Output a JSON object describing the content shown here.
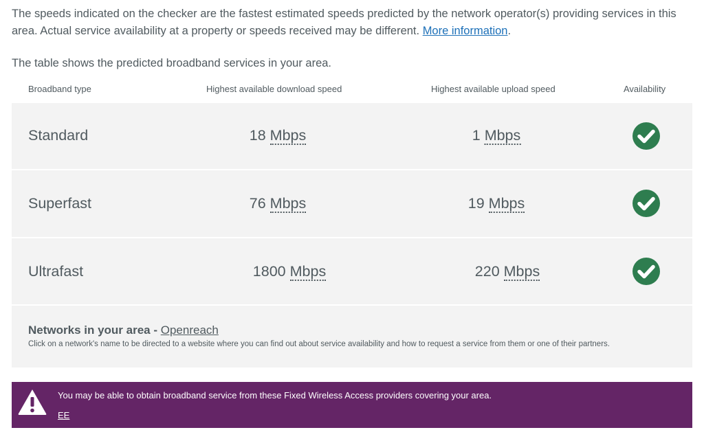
{
  "intro": {
    "text": "The speeds indicated on the checker are the fastest estimated speeds predicted by the network operator(s) providing services in this area. Actual service availability at a property or speeds received may be different.",
    "link_text": "More information",
    "after_link": "."
  },
  "table": {
    "caption": "The table shows the predicted broadband services in your area.",
    "headers": {
      "type": "Broadband type",
      "download": "Highest available download speed",
      "upload": "Highest available upload speed",
      "availability": "Availability"
    },
    "unit": "Mbps",
    "rows": [
      {
        "type": "Standard",
        "download": "18",
        "upload": "1",
        "available": true
      },
      {
        "type": "Superfast",
        "download": "76",
        "upload": "19",
        "available": true
      },
      {
        "type": "Ultrafast",
        "download": "1800",
        "upload": "220",
        "available": true
      }
    ]
  },
  "networks": {
    "title": "Networks in your area -",
    "provider": "Openreach",
    "help": "Click on a network's name to be directed to a website where you can find out about service availability and how to request a service from them or one of their partners."
  },
  "notice": {
    "text": "You may be able to obtain broadband service from these Fixed Wireless Access providers covering your area.",
    "provider": "EE",
    "icon": "warning-icon"
  },
  "colors": {
    "text": "#505a5f",
    "link": "#1d70b8",
    "row_bg": "#f3f3f3",
    "check": "#2e7d4f",
    "notice_bg": "#642566"
  }
}
